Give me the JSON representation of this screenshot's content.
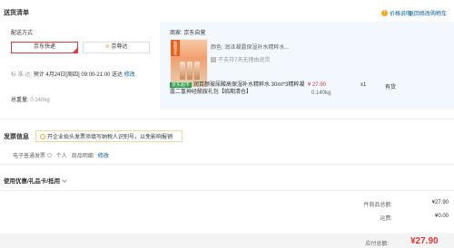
{
  "header": {
    "title": "送货清单",
    "price_note": "价格说明",
    "back_link": "返回修改购物车"
  },
  "shipping": {
    "section_label": "配送方式",
    "option_selected": "京东快递",
    "option_other": "京尊达",
    "time_label": "标 准 达:",
    "time_value": "预计 4月24日[周四] 09:00-21:00 送达",
    "time_modify": "修改",
    "weight_label": "总重量:",
    "weight_value": "0.140kg"
  },
  "goods": {
    "seller_label": "商家: 京东自营",
    "color_label": "颜色: 润泽凝露保湿补水精粹水...",
    "no_refund": "不支持7天无理由退货",
    "jd_tag": "京东超市",
    "name": "润百颜玻尿酸高保湿补水精粹水 30ml*3精粹凝露二氢神经酰胺礼包【临期清仓】",
    "price": "¥ 27.90",
    "weight": "0.140kg",
    "qty": "x1",
    "stock": "有货",
    "thumb_tag": "临期清仓"
  },
  "invoice": {
    "title": "发票信息",
    "tip": "开企业抬头发票须填写纳税人识别号，以免影响报销",
    "type": "电子普通发票",
    "holder": "个人",
    "content": "商品明细",
    "modify": "修改"
  },
  "coupons": {
    "title": "使用优惠/礼品卡/抵用"
  },
  "summary": {
    "goods_amount_label": "件商品总额:",
    "goods_amount_value": "¥27.90",
    "freight_label": "运费:",
    "freight_value": "¥0.00",
    "total_label": "应付总额:",
    "total_value": "¥27.90"
  },
  "colors": {
    "accent_red": "#e4393c",
    "link_blue": "#005ea7",
    "jd_green": "#2aa146"
  }
}
